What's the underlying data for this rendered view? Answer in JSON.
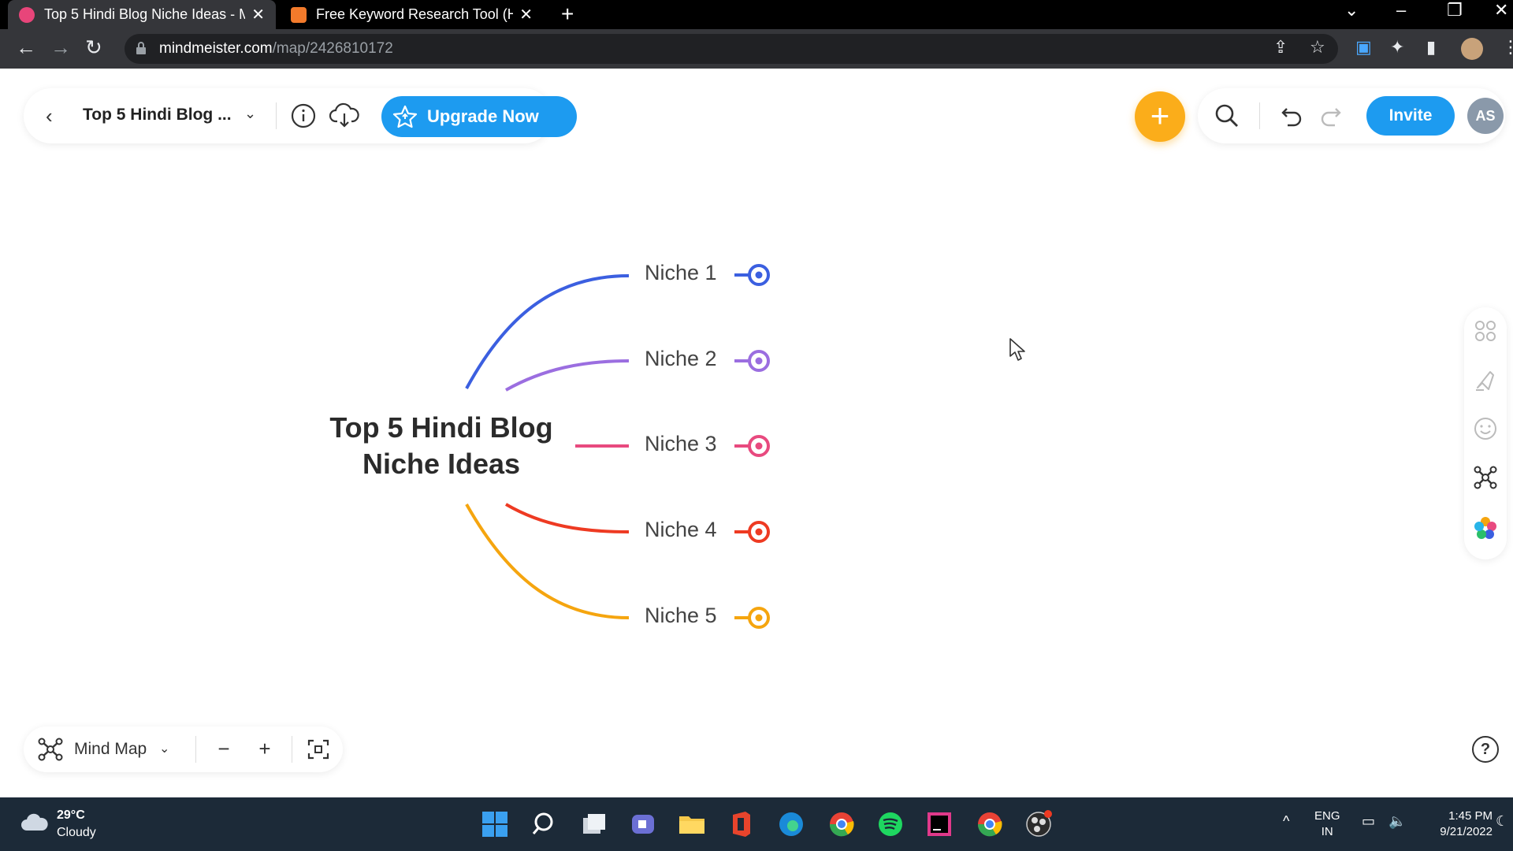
{
  "browser": {
    "tabs": [
      {
        "title": "Top 5 Hindi Blog Niche Ideas - M",
        "active": true
      },
      {
        "title": "Free Keyword Research Tool (H-s",
        "active": false
      }
    ],
    "url_host": "mindmeister.com",
    "url_path": "/map/2426810172"
  },
  "header": {
    "map_title": "Top 5 Hindi Blog ...",
    "upgrade_label": "Upgrade Now",
    "invite_label": "Invite",
    "avatar_initials": "AS",
    "accent_color": "#1d9bf0",
    "add_color": "#fbad1a"
  },
  "mindmap": {
    "root_line1": "Top 5 Hindi Blog",
    "root_line2": "Niche Ideas",
    "branches": [
      {
        "label": "Niche 1",
        "color": "#3b5fe0"
      },
      {
        "label": "Niche 2",
        "color": "#9b6ee0"
      },
      {
        "label": "Niche 3",
        "color": "#e84a7f"
      },
      {
        "label": "Niche 4",
        "color": "#ee3a22"
      },
      {
        "label": "Niche 5",
        "color": "#f5a50f"
      }
    ]
  },
  "bottom": {
    "view_label": "Mind Map",
    "help_label": "?"
  },
  "taskbar": {
    "temperature": "29°C",
    "condition": "Cloudy",
    "lang1": "ENG",
    "lang2": "IN",
    "time": "1:45 PM",
    "date": "9/21/2022"
  }
}
